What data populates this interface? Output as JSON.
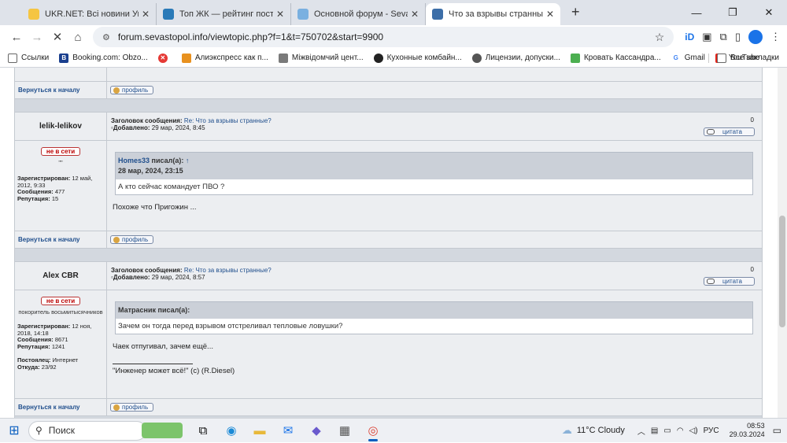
{
  "tabs": [
    {
      "title": "UKR.NET: Всі новини України, ...",
      "favicon_color": "#f5c542"
    },
    {
      "title": "Топ ЖК — рейтинг постов бл...",
      "favicon_color": "#2a7ab8"
    },
    {
      "title": "Основной форум - Sevastopol...",
      "favicon_color": "#7ab0e0"
    },
    {
      "title": "Что за взрывы странные? - Ст...",
      "favicon_color": "#3c6ea8",
      "active": true
    }
  ],
  "address": {
    "url": "forum.sevastopol.info/viewtopic.php?f=1&t=750702&start=9900"
  },
  "bookmarks": [
    {
      "label": "Ссылки",
      "icon": "folder-icon",
      "color": "#666"
    },
    {
      "label": "Booking.com: Obzo...",
      "icon": "booking-icon",
      "color": "#1a3f8e"
    },
    {
      "label": "",
      "icon": "x-logo-icon",
      "color": "#e53935"
    },
    {
      "label": "Алиэкспресс как п...",
      "icon": "aliexpress-icon",
      "color": "#e8911f"
    },
    {
      "label": "Міжвідомчий цент...",
      "icon": "building-icon",
      "color": "#7a7a7a"
    },
    {
      "label": "Кухонные комбайн...",
      "icon": "kitchen-icon",
      "color": "#222"
    },
    {
      "label": "Лицензии, допуски...",
      "icon": "globe-icon",
      "color": "#555"
    },
    {
      "label": "Кровать Кассандра...",
      "icon": "bed-icon",
      "color": "#4caf50"
    },
    {
      "label": "Gmail",
      "icon": "google-icon",
      "color": "#4285f4"
    },
    {
      "label": "YouTube",
      "icon": "youtube-icon",
      "color": "#e62117"
    }
  ],
  "bookmarks_all": "Все закладки",
  "forum": {
    "back_to_top": "Вернуться к началу",
    "profile": "профиль",
    "quote": "цитата",
    "posts": [
      {
        "author": "lelik-lelikov",
        "status": "не в сети",
        "rank": "\"\"",
        "registered_label": "Зарегистрирован:",
        "registered": "12 май, 2012, 9:33",
        "messages_label": "Сообщения:",
        "messages": "477",
        "reputation_label": "Репутация:",
        "reputation": "15",
        "subject_label": "Заголовок сообщения:",
        "subject": "Re: Что за взрывы странные?",
        "added_label": "Добавлено:",
        "added": "29 мар, 2024, 8:45",
        "num": "0",
        "quote_author": "Homes33",
        "quote_wrote": "писал(а):",
        "quote_arrow": "↑",
        "quote_date": "28 мар, 2024, 23:15",
        "quote_text": "А кто сейчас командует ПВО ?",
        "text": "Похоже что Пригожин ..."
      },
      {
        "author": "Alex CBR",
        "status": "не в сети",
        "rank": "покоритель восьмитысячников",
        "registered_label": "Зарегистрирован:",
        "registered": "12 ноя, 2018, 14:18",
        "messages_label": "Сообщения:",
        "messages": "8671",
        "reputation_label": "Репутация:",
        "reputation": "1241",
        "resident_label": "Постоялец:",
        "resident": "Интернет",
        "from_label": "Откуда:",
        "from": "23/92",
        "subject_label": "Заголовок сообщения:",
        "subject": "Re: Что за взрывы странные?",
        "added_label": "Добавлено:",
        "added": "29 мар, 2024, 8:57",
        "num": "0",
        "quote_author": "Матрасник писал(а):",
        "quote_text": "Зачем он тогда перед взрывом отстреливал тепловые ловушки?",
        "text": "Чаек отпугивал, зачем ещё...",
        "signature": "\"Инженер может всё!\" (с) (R.Diesel)"
      }
    ]
  },
  "taskbar": {
    "search": "Поиск",
    "weather": "11°C  Cloudy",
    "lang": "РУС",
    "time": "08:53",
    "date": "29.03.2024"
  }
}
